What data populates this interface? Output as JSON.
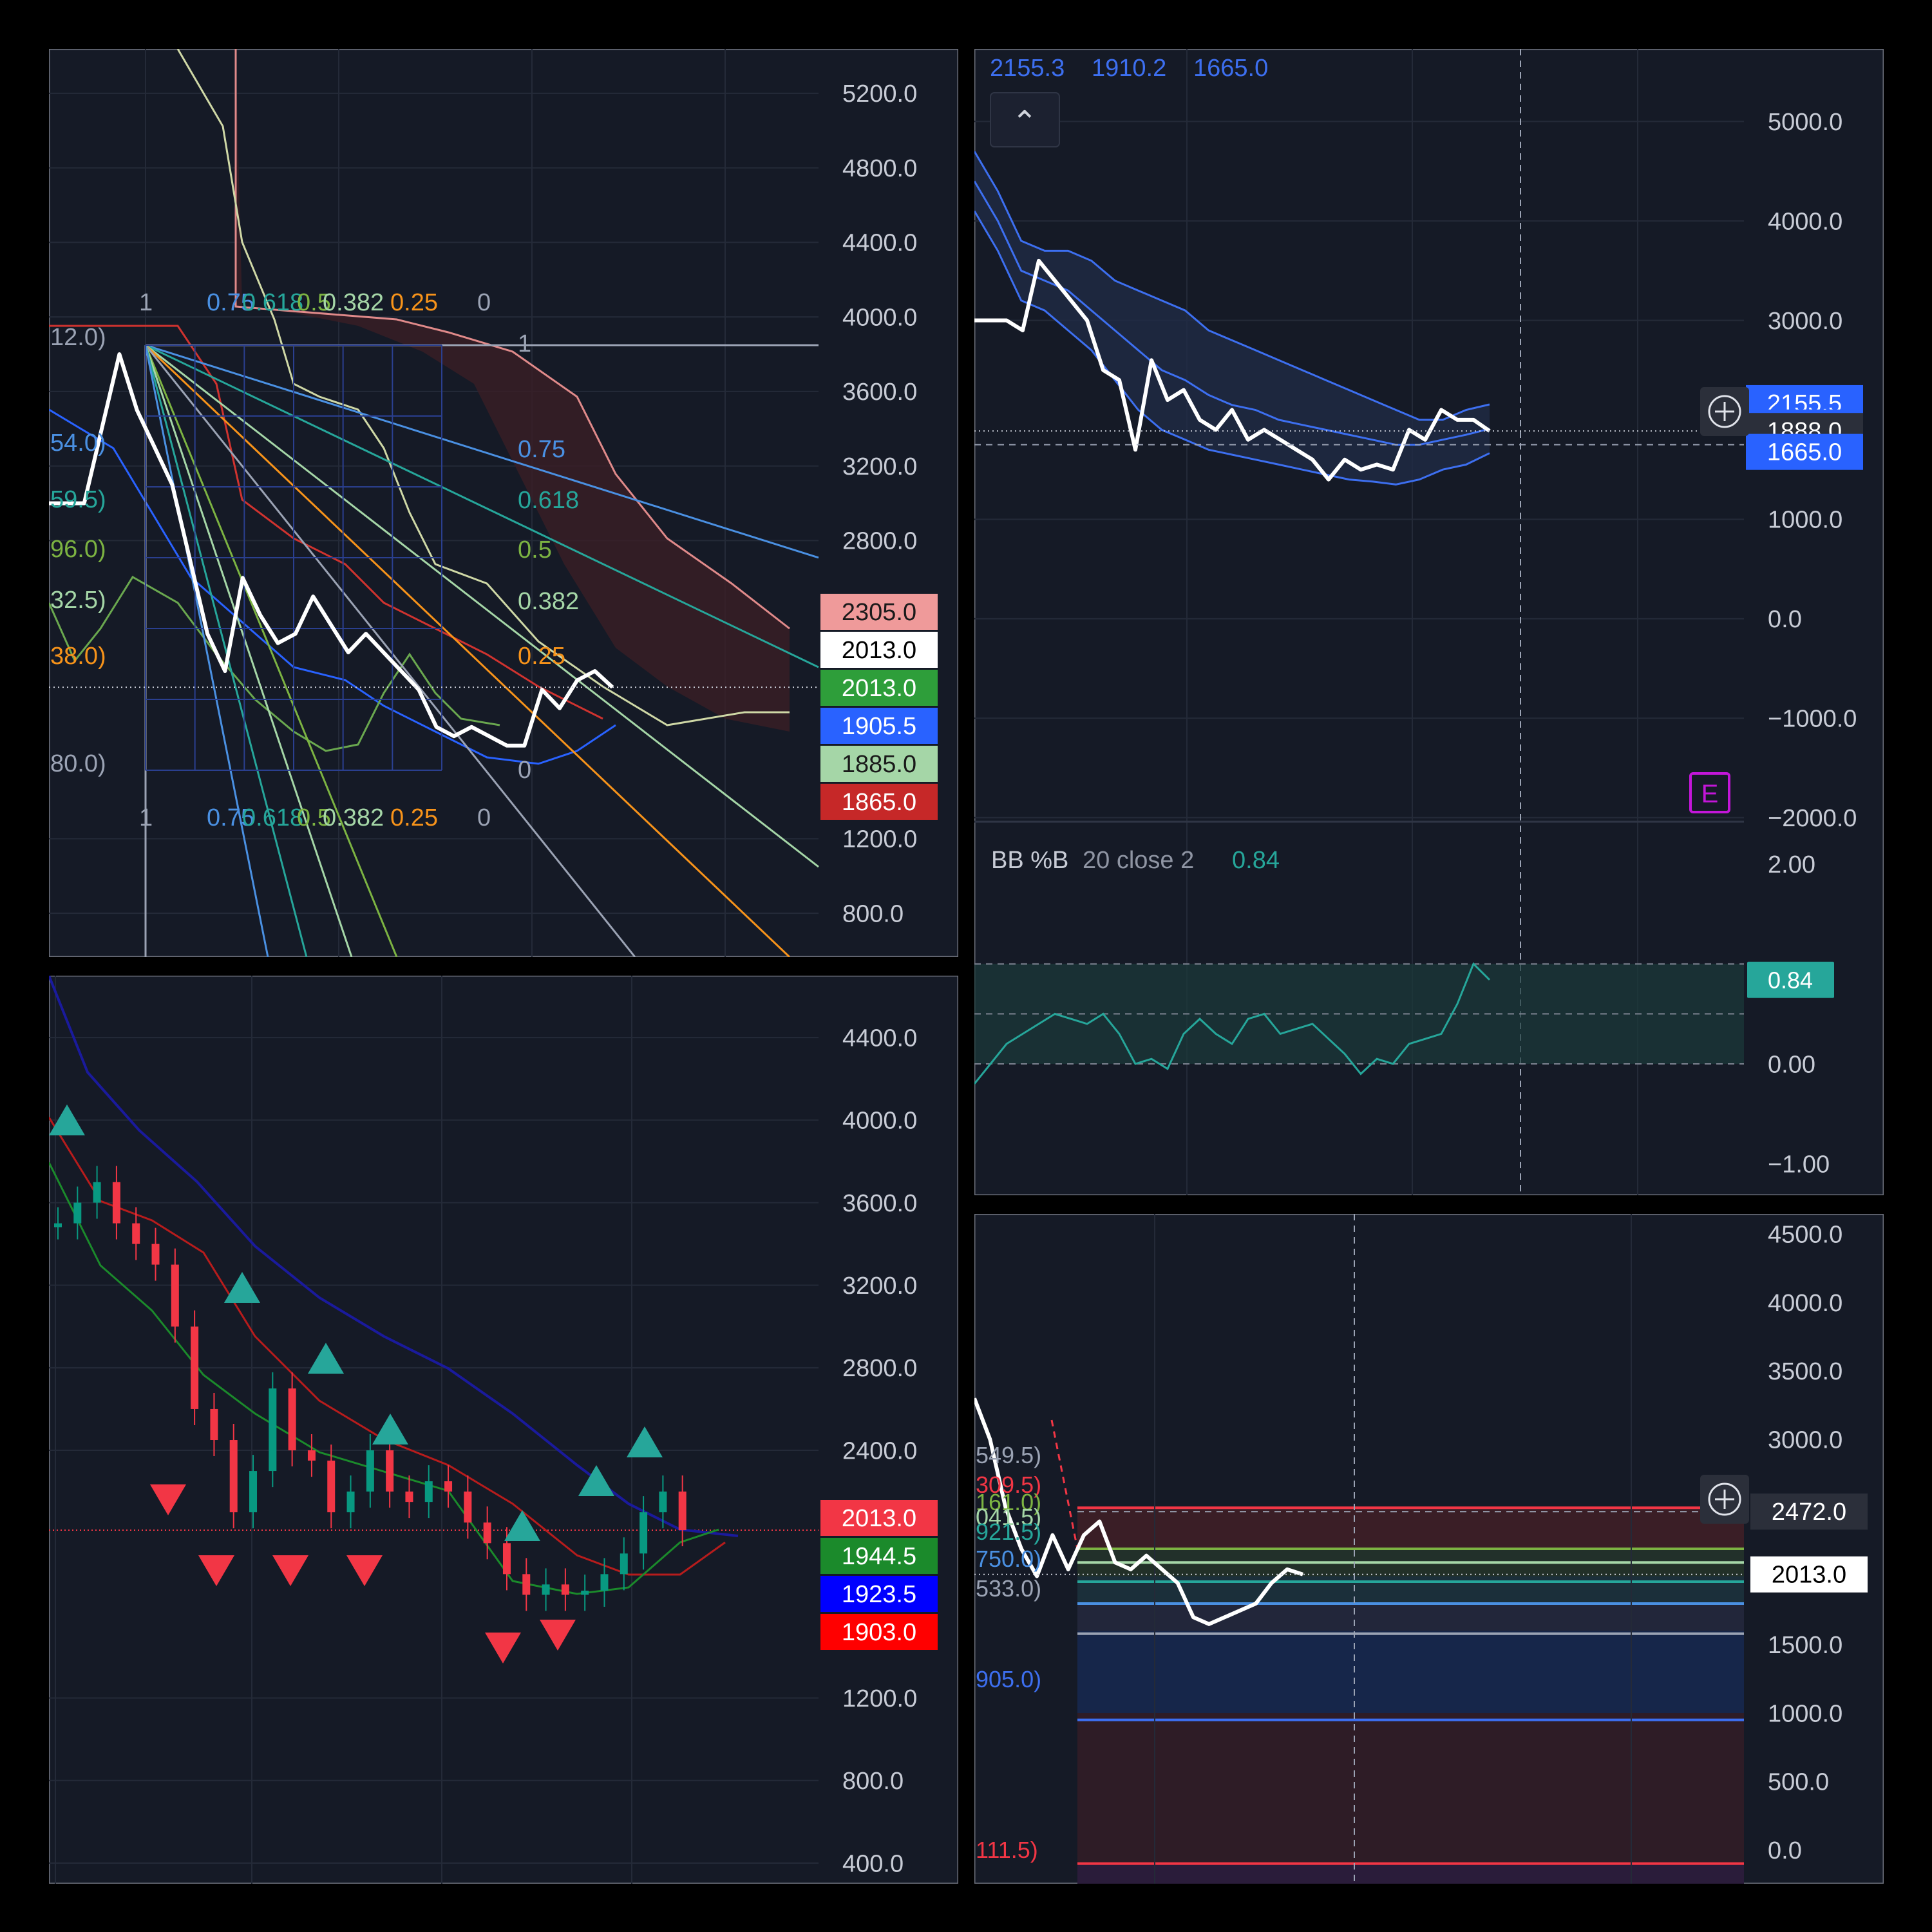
{
  "colors": {
    "background": "#000000",
    "panel_bg": "#151a26",
    "grid": "#242a38",
    "axis_text": "#c8ccd6",
    "price_line": "#ffffff",
    "bb_blue": "#3d6ff0",
    "teal": "#26a69a",
    "red_candle": "#f23645",
    "green_candle": "#089981",
    "orange": "#f7931a",
    "pink": "#e08a8a",
    "purple": "#c216d8"
  },
  "panels": {
    "tl": {
      "y_axis": [
        {
          "v": 5200,
          "t": "5200.0"
        },
        {
          "v": 4800,
          "t": "4800.0"
        },
        {
          "v": 4400,
          "t": "4400.0"
        },
        {
          "v": 4000,
          "t": "4000.0"
        },
        {
          "v": 3600,
          "t": "3600.0"
        },
        {
          "v": 3200,
          "t": "3200.0"
        },
        {
          "v": 2800,
          "t": "2800.0"
        },
        {
          "v": 1200,
          "t": "1200.0"
        },
        {
          "v": 800,
          "t": "800.0"
        }
      ],
      "price_tags": [
        {
          "text": "2305.0",
          "bg": "#ef9a9a",
          "fg": "#1a1a1a"
        },
        {
          "text": "2013.0",
          "bg": "#ffffff",
          "fg": "#000000"
        },
        {
          "text": "2013.0",
          "bg": "#2e9e3a",
          "fg": "#ffffff"
        },
        {
          "text": "1905.5",
          "bg": "#2962ff",
          "fg": "#ffffff"
        },
        {
          "text": "1885.0",
          "bg": "#a5d6a7",
          "fg": "#1a1a1a"
        },
        {
          "text": "1865.0",
          "bg": "#c62828",
          "fg": "#ffffff"
        }
      ],
      "left_labels": [
        {
          "text": "12.0)",
          "color": "#9ba3b4"
        },
        {
          "text": "54.0)",
          "color": "#4a90e2"
        },
        {
          "text": "59.5)",
          "color": "#26a69a"
        },
        {
          "text": "96.0)",
          "color": "#7cb342"
        },
        {
          "text": "32.5)",
          "color": "#a5d6a7"
        },
        {
          "text": "38.0)",
          "color": "#f7931a"
        },
        {
          "text": "80.0)",
          "color": "#9ba3b4"
        }
      ],
      "fib_top": [
        {
          "text": "1",
          "color": "#9ba3b4"
        },
        {
          "text": "0.75",
          "color": "#4a90e2"
        },
        {
          "text": "0.618",
          "color": "#26a69a"
        },
        {
          "text": "0.5",
          "color": "#7cb342"
        },
        {
          "text": "0.382",
          "color": "#a5d6a7"
        },
        {
          "text": "0.25",
          "color": "#f7931a"
        },
        {
          "text": "0",
          "color": "#9ba3b4"
        }
      ],
      "fib_bottom": [
        {
          "text": "1",
          "color": "#9ba3b4"
        },
        {
          "text": "0.75",
          "color": "#4a90e2"
        },
        {
          "text": "0.618",
          "color": "#26a69a"
        },
        {
          "text": "0.5",
          "color": "#7cb342"
        },
        {
          "text": "0.382",
          "color": "#a5d6a7"
        },
        {
          "text": "0.25",
          "color": "#f7931a"
        },
        {
          "text": "0",
          "color": "#9ba3b4"
        }
      ],
      "fan_labels": [
        {
          "text": "1",
          "color": "#9ba3b4"
        },
        {
          "text": "0.75",
          "color": "#4a90e2"
        },
        {
          "text": "0.618",
          "color": "#26a69a"
        },
        {
          "text": "0.5",
          "color": "#7cb342"
        },
        {
          "text": "0.382",
          "color": "#a5d6a7"
        },
        {
          "text": "0.25",
          "color": "#f7931a"
        },
        {
          "text": "0",
          "color": "#9ba3b4"
        }
      ]
    },
    "tr": {
      "legend": {
        "v1": "2155.3",
        "v2": "1910.2",
        "v3": "1665.0"
      },
      "collapse_glyph": "⌃",
      "y_axis": [
        {
          "v": 5000,
          "t": "5000.0"
        },
        {
          "v": 4000,
          "t": "4000.0"
        },
        {
          "v": 3000,
          "t": "3000.0"
        },
        {
          "v": 1000,
          "t": "1000.0"
        },
        {
          "v": 0,
          "t": "0.0"
        },
        {
          "v": -1000,
          "t": "−1000.0"
        },
        {
          "v": -2000,
          "t": "−2000.0"
        }
      ],
      "price_tags": [
        {
          "text": "2155.5",
          "bg": "#2962ff",
          "fg": "#ffffff"
        },
        {
          "text": "1910.0",
          "bg": "#2962ff",
          "fg": "#ffffff"
        },
        {
          "text": "1888.0",
          "bg": "#2b2f3a",
          "fg": "#ffffff"
        },
        {
          "text": "1665.0",
          "bg": "#2962ff",
          "fg": "#ffffff"
        }
      ],
      "earnings_badge": "E",
      "indicator": {
        "name": "BB %B",
        "params": "20 close 2",
        "value": "0.84"
      },
      "indicator_axis": [
        {
          "v": 2,
          "t": "2.00"
        },
        {
          "v": 0,
          "t": "0.00"
        },
        {
          "v": -1,
          "t": "−1.00"
        }
      ],
      "indicator_tag": {
        "text": "0.84",
        "bg": "#26a69a",
        "fg": "#ffffff"
      }
    },
    "bl": {
      "y_axis": [
        {
          "v": 4400,
          "t": "4400.0"
        },
        {
          "v": 4000,
          "t": "4000.0"
        },
        {
          "v": 3600,
          "t": "3600.0"
        },
        {
          "v": 3200,
          "t": "3200.0"
        },
        {
          "v": 2800,
          "t": "2800.0"
        },
        {
          "v": 2400,
          "t": "2400.0"
        },
        {
          "v": 1200,
          "t": "1200.0"
        },
        {
          "v": 800,
          "t": "800.0"
        },
        {
          "v": 400,
          "t": "400.0"
        }
      ],
      "price_tags": [
        {
          "text": "2013.0",
          "bg": "#f23645",
          "fg": "#ffffff"
        },
        {
          "text": "1944.5",
          "bg": "#1b8a2b",
          "fg": "#ffffff"
        },
        {
          "text": "1923.5",
          "bg": "#0000ff",
          "fg": "#ffffff"
        },
        {
          "text": "1903.0",
          "bg": "#ff0000",
          "fg": "#ffffff"
        }
      ]
    },
    "br": {
      "y_axis": [
        {
          "v": 4500,
          "t": "4500.0"
        },
        {
          "v": 4000,
          "t": "4000.0"
        },
        {
          "v": 3500,
          "t": "3500.0"
        },
        {
          "v": 3000,
          "t": "3000.0"
        },
        {
          "v": 1500,
          "t": "1500.0"
        },
        {
          "v": 1000,
          "t": "1000.0"
        },
        {
          "v": 500,
          "t": "500.0"
        },
        {
          "v": 0,
          "t": "0.0"
        }
      ],
      "price_tags": [
        {
          "text": "2472.0",
          "bg": "#2b2f3a",
          "fg": "#ffffff"
        },
        {
          "text": "2013.0",
          "bg": "#ffffff",
          "fg": "#000000"
        }
      ],
      "left_labels": [
        {
          "text": "549.5)",
          "color": "#9ba3b4"
        },
        {
          "text": "309.5)",
          "color": "#f23645"
        },
        {
          "text": "161.0)",
          "color": "#7cb342"
        },
        {
          "text": "041.5)",
          "color": "#a5d6a7"
        },
        {
          "text": "921.5)",
          "color": "#26a69a"
        },
        {
          "text": "750.0)",
          "color": "#4a90e2"
        },
        {
          "text": "533.0)",
          "color": "#9ba3b4"
        },
        {
          "text": "905.0)",
          "color": "#3d6ff0"
        },
        {
          "text": "111.5)",
          "color": "#f23645"
        }
      ]
    }
  },
  "chart_data": [
    {
      "type": "line",
      "panel": "top-left",
      "ylim": [
        600,
        5300
      ],
      "series": [
        {
          "values": [
            3000,
            3000,
            3000,
            3400,
            3800,
            3500,
            3300,
            3100,
            2700,
            2300,
            2100,
            2600,
            2400,
            2250,
            2300,
            2500,
            2350,
            2200,
            2300,
            2200,
            2100,
            2000,
            1800,
            1750,
            1800,
            1750,
            1700,
            1700,
            2000,
            1900,
            2050,
            2100,
            2013
          ]
        }
      ]
    },
    {
      "type": "line",
      "panel": "top-right",
      "ylim": [
        -2300,
        5600
      ],
      "series": [
        {
          "values": [
            3000,
            3000,
            3000,
            2900,
            3600,
            3400,
            3200,
            3000,
            2500,
            2400,
            1700,
            2600,
            2200,
            2300,
            2000,
            1900,
            2100,
            1800,
            1900,
            1800,
            1700,
            1600,
            1400,
            1600,
            1500,
            1550,
            1500,
            1900,
            1800,
            2100,
            2000,
            2000,
            1888
          ]
        },
        {
          "values": [
            4700,
            4300,
            3800,
            3700,
            3700,
            3600,
            3400,
            3300,
            3200,
            3100,
            2900,
            2800,
            2700,
            2600,
            2500,
            2400,
            2300,
            2200,
            2100,
            2000,
            2000,
            2100,
            2155
          ]
        },
        {
          "values": [
            4400,
            4000,
            3500,
            3400,
            3300,
            3100,
            2900,
            2700,
            2500,
            2400,
            2250,
            2150,
            2100,
            2000,
            1950,
            1900,
            1850,
            1800,
            1750,
            1750,
            1800,
            1850,
            1910
          ]
        },
        {
          "values": [
            4100,
            3700,
            3200,
            3100,
            2900,
            2700,
            2400,
            2100,
            1900,
            1800,
            1700,
            1650,
            1600,
            1550,
            1500,
            1450,
            1400,
            1380,
            1350,
            1400,
            1500,
            1550,
            1665
          ]
        }
      ]
    },
    {
      "type": "line",
      "panel": "top-right-indicator",
      "ylim": [
        -1.25,
        2.1
      ],
      "series": [
        {
          "values": [
            -0.2,
            0.0,
            0.2,
            0.3,
            0.4,
            0.5,
            0.45,
            0.4,
            0.5,
            0.3,
            0.0,
            0.05,
            -0.05,
            0.3,
            0.45,
            0.3,
            0.2,
            0.45,
            0.5,
            0.3,
            0.35,
            0.4,
            0.25,
            0.1,
            -0.1,
            0.05,
            0.0,
            0.2,
            0.25,
            0.3,
            0.6,
            1.0,
            0.84
          ]
        }
      ]
    },
    {
      "type": "line",
      "panel": "bottom-left",
      "ylim": [
        300,
        4700
      ],
      "series": [
        {
          "values": [
            3500,
            3600,
            3700,
            3500,
            3400,
            3300,
            3000,
            2600,
            2450,
            2100,
            2300,
            2700,
            2400,
            2350,
            2100,
            2200,
            2400,
            2200,
            2150,
            2250,
            2200,
            2050,
            1950,
            1800,
            1700,
            1750,
            1700,
            1720,
            1800,
            1900,
            2100,
            2200,
            2013
          ]
        }
      ]
    },
    {
      "type": "line",
      "panel": "bottom-right",
      "ylim": [
        -200,
        4600
      ],
      "series": [
        {
          "values": [
            3300,
            3000,
            2500,
            2200,
            2000,
            2300,
            2050,
            2300,
            2400,
            2100,
            2050,
            2150,
            2050,
            1950,
            1700,
            1650,
            1700,
            1750,
            1800,
            1950,
            2050,
            2013
          ]
        }
      ]
    }
  ]
}
